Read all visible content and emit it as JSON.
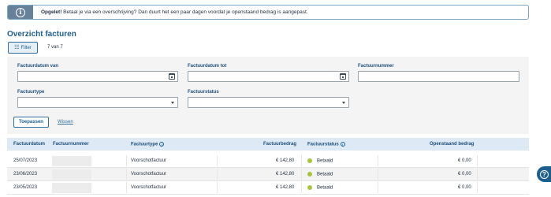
{
  "alert": {
    "title": "Opgelet!",
    "message": " Betaal je via een overschrijving? Dan duurt het een paar dagen voordat je openstaand bedrag is aangepast.",
    "icon": "info-icon"
  },
  "page_title": "Overzicht facturen",
  "filter_button": {
    "label": "Filter",
    "icon": "filter-sliders-icon"
  },
  "result_count": "7 van 7",
  "filters": {
    "date_from": {
      "label": "Factuurdatum van",
      "value": ""
    },
    "date_to": {
      "label": "Factuurdatum tot",
      "value": ""
    },
    "number": {
      "label": "Factuurnummer",
      "value": ""
    },
    "type": {
      "label": "Factuurtype",
      "value": ""
    },
    "status": {
      "label": "Factuurstatus",
      "value": ""
    }
  },
  "apply_label": "Toepassen",
  "clear_label": "Wissen",
  "table": {
    "columns": [
      "Factuurdatum",
      "Factuurnummer",
      "Factuurtype",
      "Factuurbedrag",
      "Factuurstatus",
      "Openstaand bedrag"
    ],
    "rows": [
      {
        "date": "25/07/2023",
        "number": "",
        "type": "Voorschotfactuur",
        "amount": "€ 142,80",
        "status": "Betaald",
        "open": "€ 0,00"
      },
      {
        "date": "23/06/2023",
        "number": "",
        "type": "Voorschotfactuur",
        "amount": "€ 142,80",
        "status": "Betaald",
        "open": "€ 0,00"
      },
      {
        "date": "23/05/2023",
        "number": "",
        "type": "Voorschotfactuur",
        "amount": "€ 142,80",
        "status": "Betaald",
        "open": "€ 0,00"
      }
    ]
  },
  "colors": {
    "accent": "#1e5e8e",
    "status_paid": "#a8c43b"
  },
  "help_icon": "help-icon"
}
